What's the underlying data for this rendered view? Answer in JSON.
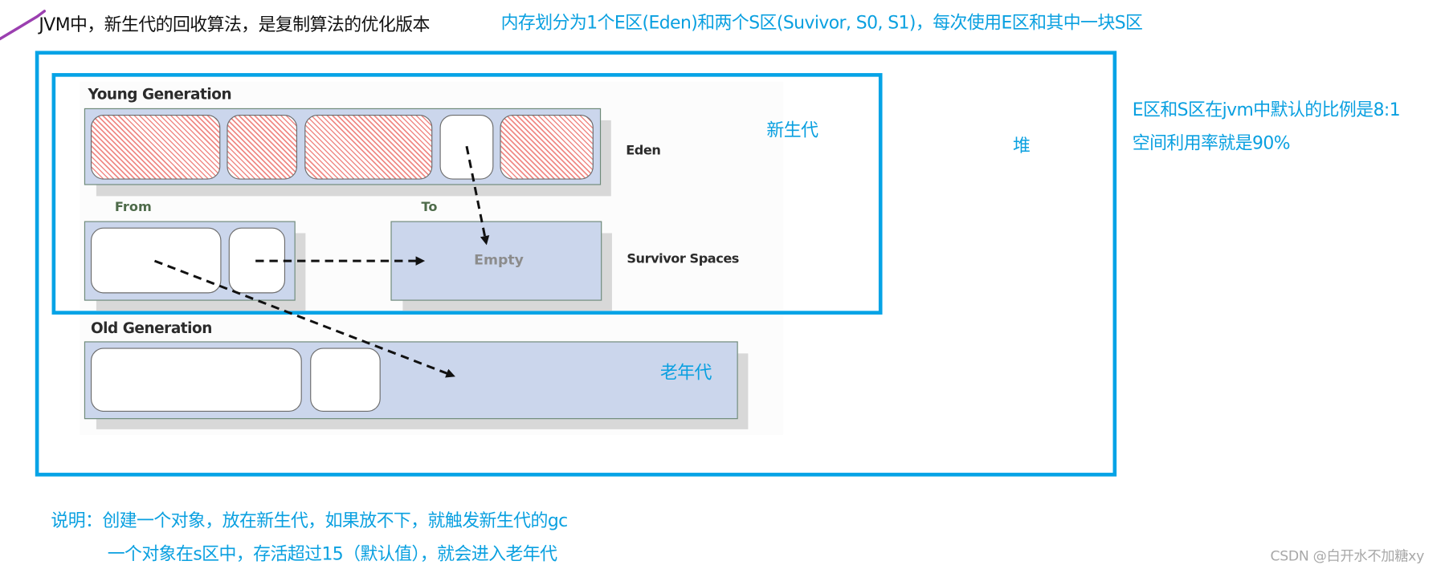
{
  "header": {
    "title": "JVM中，新生代的回收算法，是复制算法的优化版本",
    "note": "内存划分为1个E区(Eden)和两个S区(Suvivor, S0, S1)，每次使用E区和其中一块S区"
  },
  "diagram": {
    "young_generation_title": "Young Generation",
    "eden_label": "Eden",
    "from_label": "From",
    "to_label": "To",
    "empty_label": "Empty",
    "survivor_label": "Survivor Spaces",
    "old_generation_title": "Old Generation",
    "eden_slots": [
      {
        "state": "occupied"
      },
      {
        "state": "occupied"
      },
      {
        "state": "occupied"
      },
      {
        "state": "free"
      },
      {
        "state": "occupied"
      }
    ],
    "from_slots": [
      {
        "state": "free"
      },
      {
        "state": "free"
      }
    ],
    "old_slots": [
      {
        "state": "free"
      },
      {
        "state": "free"
      }
    ],
    "arrows": [
      {
        "from": "eden-free-slot",
        "to": "to-space"
      },
      {
        "from": "from-small-slot",
        "to": "to-space"
      },
      {
        "from": "from-large-slot",
        "to": "old-generation"
      }
    ]
  },
  "annotations": {
    "young_gen_cn": "新生代",
    "heap_cn": "堆",
    "old_gen_cn": "老年代",
    "ratio_line1": "E区和S区在jvm中默认的比例是8:1",
    "ratio_line2": "空间利用率就是90%"
  },
  "footer": {
    "line1": "说明：创建一个对象，放在新生代，如果放不下，就触发新生代的gc",
    "line2": "一个对象在s区中，存活超过15（默认值），就会进入老年代"
  },
  "watermark": "CSDN @白开水不加糖xy",
  "colors": {
    "accent_blue": "#06a3e6",
    "annotation_blue": "#0aa0e0",
    "panel_fill": "#cbd6ec",
    "hatch_red": "#f08a86",
    "pen_purple": "#9b3fb0"
  }
}
